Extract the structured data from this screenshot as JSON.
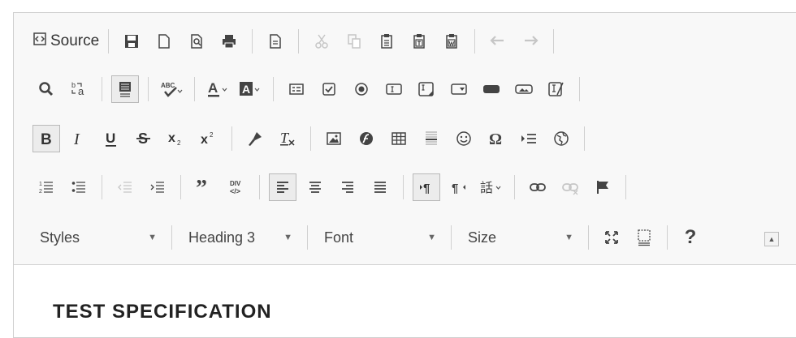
{
  "toolbar": {
    "source_label": "Source",
    "styles_combo": "Styles",
    "format_combo": "Heading 3",
    "font_combo": "Font",
    "size_combo": "Size",
    "help_glyph": "?"
  },
  "content": {
    "heading": "TEST SPECIFICATION"
  }
}
